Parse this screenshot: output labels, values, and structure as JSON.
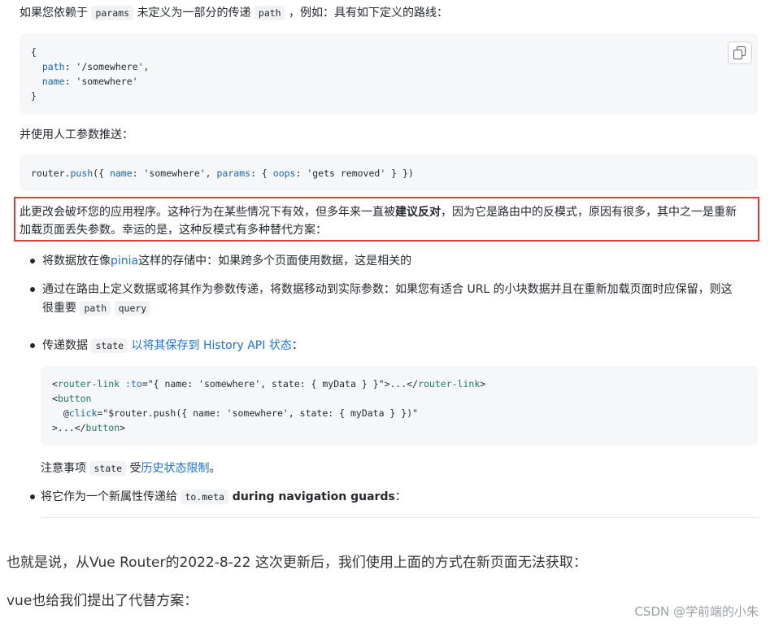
{
  "intro": {
    "before": "如果您依赖于 ",
    "code1": "params",
    "mid": " 未定义为一部分的传递 ",
    "code2": "path",
    "after": " ，例如：具有如下定义的路线："
  },
  "code_block_1": {
    "line1": "{",
    "line2_key": "path",
    "line2_val": ": '/somewhere',",
    "line3_key": "name",
    "line3_val": ": 'somewhere'",
    "line4": "}",
    "copy_icon": "copy-icon"
  },
  "push_intro": "并使用人工参数推送：",
  "code_block_2": {
    "p1": "router.",
    "p2": "push",
    "p3": "({ ",
    "p4": "name",
    "p5": ": 'somewhere', ",
    "p6": "params",
    "p7": ": { ",
    "p8": "oops",
    "p9": ": 'gets removed' } })"
  },
  "warning": {
    "line1_a": "此更改会破坏您的应用程序。这种行为在某些情况下有效，但多年来一直被",
    "line1_bold": "建议反对",
    "line1_b": "，因为它是路由中的反模式，原因有很多，其中之一是重新",
    "line2": "加载页面丢失参数。幸运的是，这种反模式有多种替代方案："
  },
  "bullets": {
    "b1_a": "将数据放在像",
    "b1_link": "pinia",
    "b1_b": "这样的存储中：如果跨多个页面使用数据，这是相关的",
    "b2_line1": "通过在路由上定义数据或将其作为参数传递，将数据移动到实际参数：如果您有适合 URL 的小块数据并且在重新加载页面时应保留，则这",
    "b2_line2": "很重要 ",
    "b2_code1": "path",
    "b2_code2": "query",
    "b3_a": "传递数据 ",
    "b3_code": "state",
    "b3_link": " 以将其保存到 History API 状态",
    "b3_b": "：",
    "b4_a": "将它作为一个新属性传递给 ",
    "b4_code": "to.meta",
    "b4_bold": " during navigation guards",
    "b4_b": "："
  },
  "code_block_3": {
    "l1_a": "<",
    "l1_tag": "router-link",
    "l1_attr": " :to",
    "l1_val": "=\"{ name: 'somewhere', state: { myData } }\">...</",
    "l1_tag2": "router-link",
    "l1_end": ">",
    "l2_a": "<",
    "l2_tag": "button",
    "l3_a": "  @",
    "l3_attr": "click",
    "l3_val": "=\"$router.push({ name: 'somewhere', state: { myData } })\"",
    "l4_a": ">...</",
    "l4_tag": "button",
    "l4_end": ">"
  },
  "note": {
    "a": "注意事项 ",
    "code": "state",
    "b": " 受",
    "link": "历史状态限制",
    "c": "。"
  },
  "summary1": "也就是说，从Vue Router的2022-8-22 这次更新后，我们使用上面的方式在新页面无法获取：",
  "summary2": "vue也给我们提出了代替方案：",
  "watermark": "CSDN @学前端的小朱"
}
